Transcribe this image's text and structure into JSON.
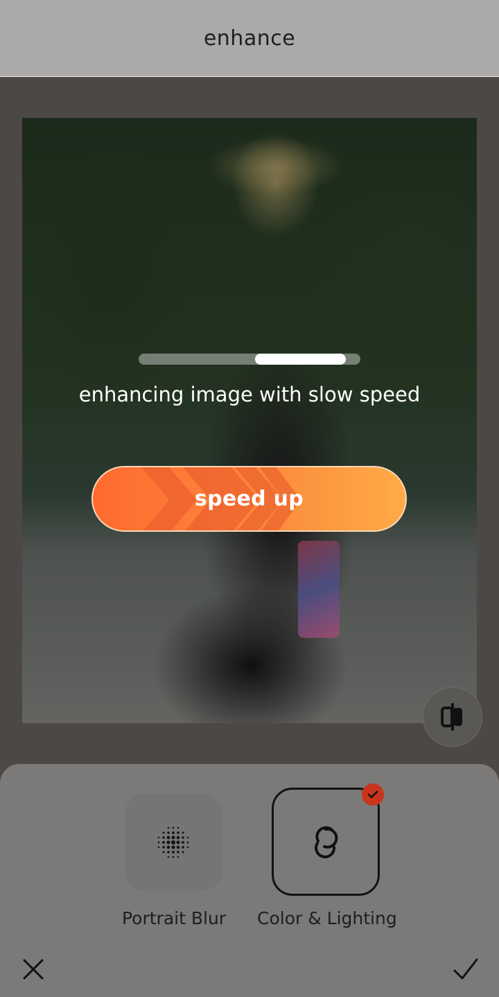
{
  "header": {
    "title": "enhance"
  },
  "processing": {
    "status_text": "enhancing image with slow speed",
    "speed_button_label": "speed up"
  },
  "tools": [
    {
      "label": "Portrait Blur",
      "icon": "dot-grid-icon",
      "selected": false
    },
    {
      "label": "Color & Lighting",
      "icon": "interlocking-circles-icon",
      "selected": true
    }
  ],
  "actions": {
    "close_icon": "close-icon",
    "confirm_icon": "checkmark-icon",
    "compare_icon": "compare-icon"
  },
  "colors": {
    "speed_start": "#ff6a2f",
    "speed_end": "#ffab47",
    "badge": "#c8341c"
  }
}
